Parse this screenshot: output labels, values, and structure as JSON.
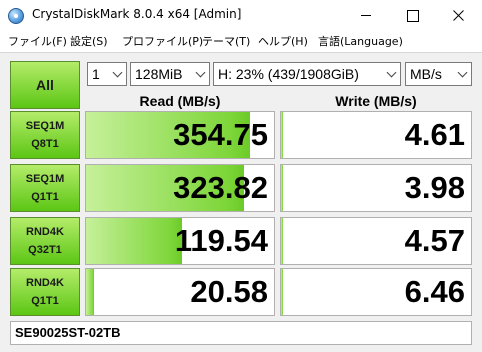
{
  "window": {
    "title": "CrystalDiskMark 8.0.4 x64 [Admin]"
  },
  "menu": [
    "ファイル(F)",
    "設定(S)",
    "プロファイル(P)",
    "テーマ(T)",
    "ヘルプ(H)",
    "言語(Language)"
  ],
  "toolbar": {
    "all_label": "All",
    "count": "1",
    "size": "128MiB",
    "drive": "H: 23% (439/1908GiB)",
    "unit": "MB/s"
  },
  "headers": {
    "read": "Read (MB/s)",
    "write": "Write (MB/s)"
  },
  "tests": [
    {
      "line1": "SEQ1M",
      "line2": "Q8T1",
      "read": "354.75",
      "write": "4.61",
      "read_fill": 0.87,
      "write_fill": 0.01
    },
    {
      "line1": "SEQ1M",
      "line2": "Q1T1",
      "read": "323.82",
      "write": "3.98",
      "read_fill": 0.84,
      "write_fill": 0.01
    },
    {
      "line1": "RND4K",
      "line2": "Q32T1",
      "read": "119.54",
      "write": "4.57",
      "read_fill": 0.51,
      "write_fill": 0.01
    },
    {
      "line1": "RND4K",
      "line2": "Q1T1",
      "read": "20.58",
      "write": "6.46",
      "read_fill": 0.04,
      "write_fill": 0.01
    }
  ],
  "comment": "SE90025ST-02TB",
  "colors": {
    "accent_green": "#5cc614",
    "bar_green": "#7ed63a"
  }
}
